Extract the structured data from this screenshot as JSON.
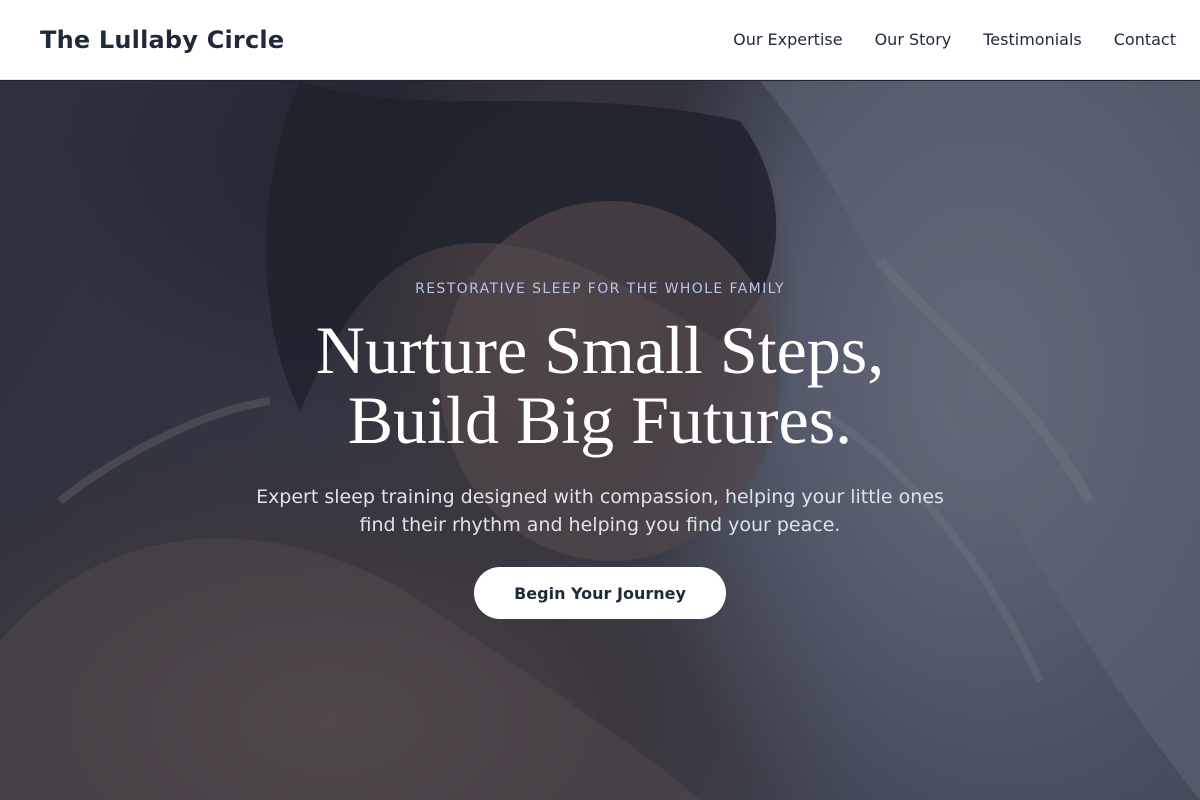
{
  "header": {
    "brand": "The Lullaby Circle",
    "nav": [
      {
        "label": "Our Expertise"
      },
      {
        "label": "Our Story"
      },
      {
        "label": "Testimonials"
      },
      {
        "label": "Contact"
      }
    ]
  },
  "hero": {
    "eyebrow": "RESTORATIVE SLEEP FOR THE WHOLE FAMILY",
    "headline_line1": "Nurture Small Steps,",
    "headline_line2": "Build Big Futures.",
    "subtext": "Expert sleep training designed with compassion, helping your little ones find their rhythm and helping you find your peace.",
    "cta_label": "Begin Your Journey"
  }
}
